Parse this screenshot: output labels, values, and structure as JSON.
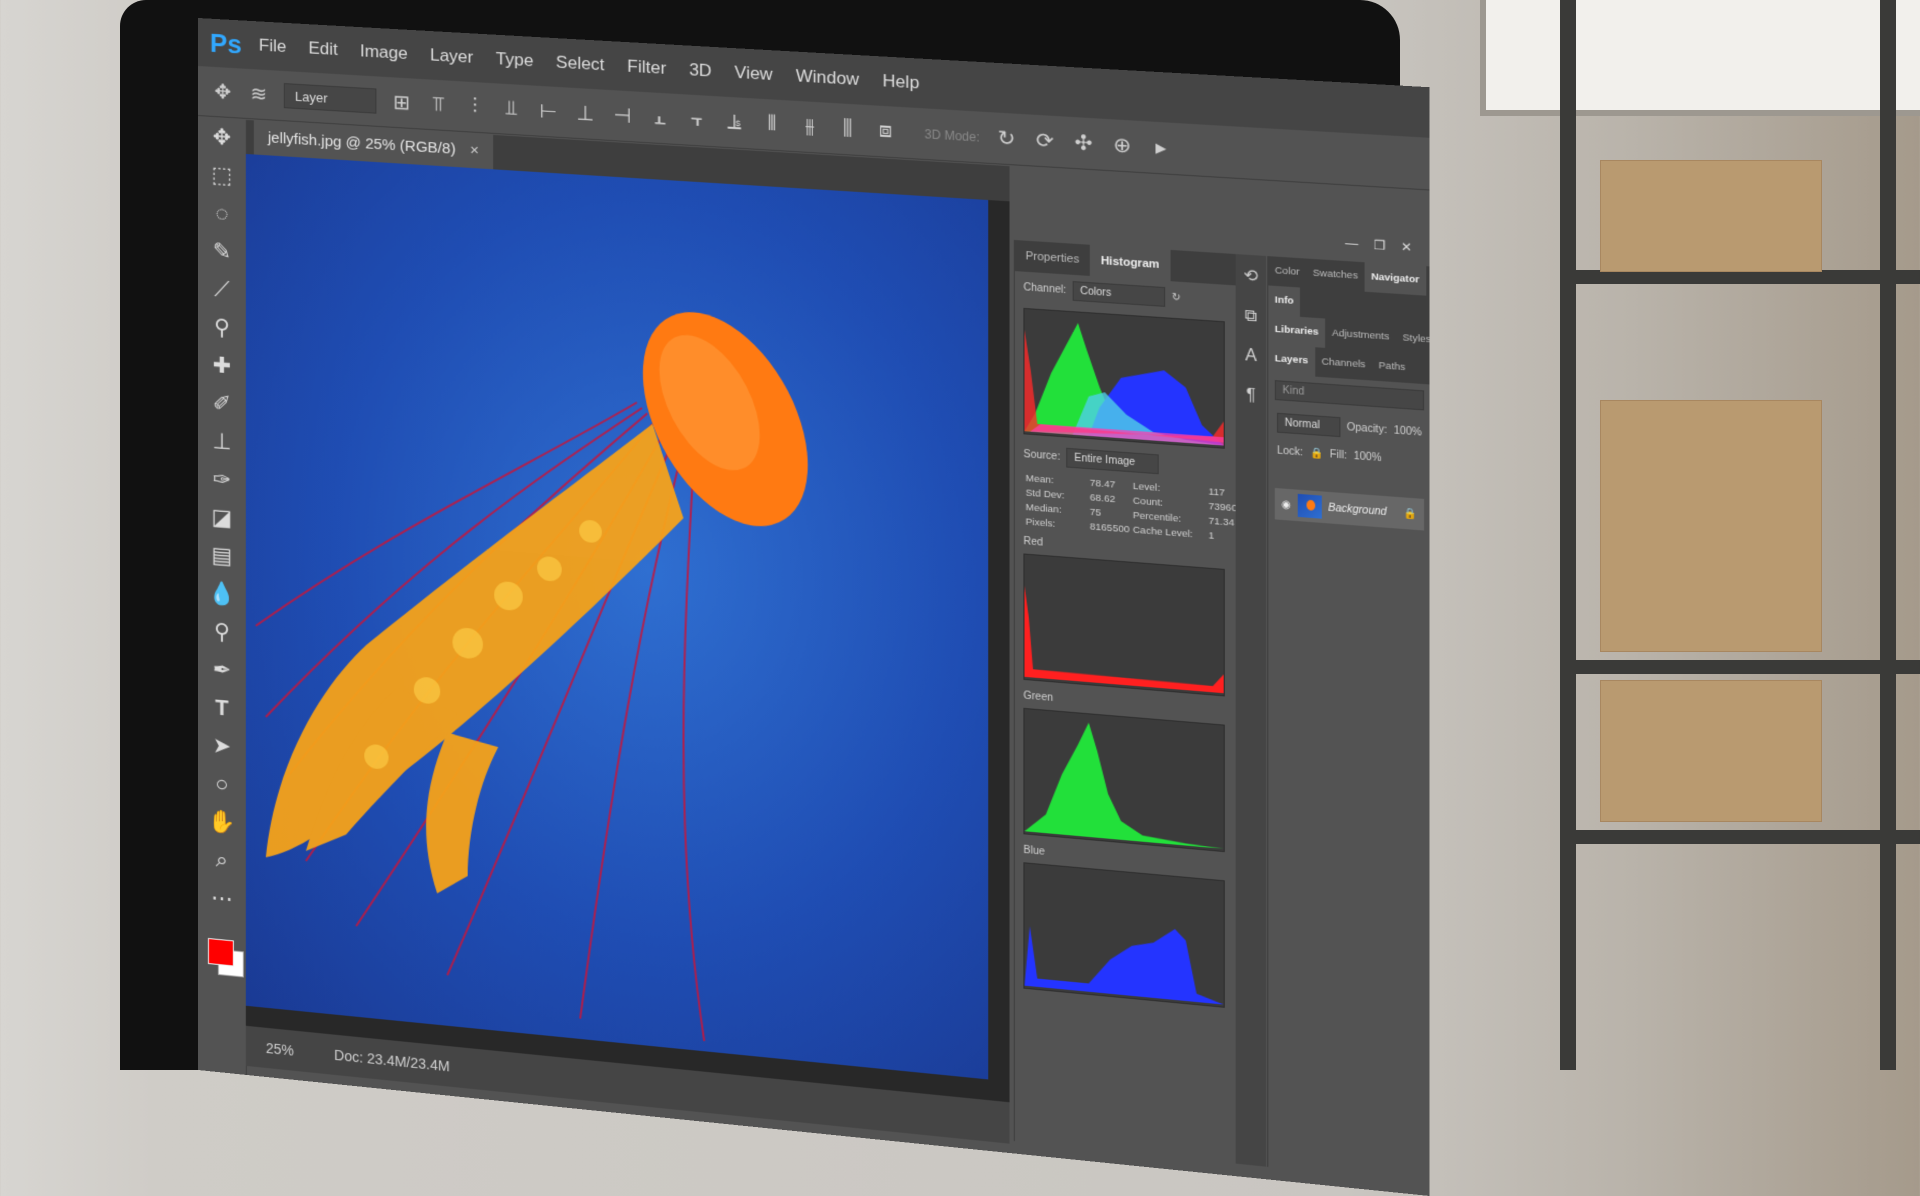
{
  "app": {
    "logo": "Ps",
    "menu": [
      "File",
      "Edit",
      "Image",
      "Layer",
      "Type",
      "Select",
      "Filter",
      "3D",
      "View",
      "Window",
      "Help"
    ]
  },
  "options_bar": {
    "auto_select": "Layer",
    "mode_3d": "3D Mode:"
  },
  "document": {
    "tab_title": "jellyfish.jpg @ 25% (RGB/8)",
    "close_glyph": "×",
    "zoom": "25%",
    "doc_info": "Doc: 23.4M/23.4M"
  },
  "histogram_panel": {
    "tabs": [
      "Properties",
      "Histogram"
    ],
    "active_tab": "Histogram",
    "channel_label": "Channel:",
    "channel_value": "Colors",
    "source_label": "Source:",
    "source_value": "Entire Image",
    "stats": {
      "mean_label": "Mean:",
      "mean": "78.47",
      "std_dev_label": "Std Dev:",
      "std_dev": "68.62",
      "median_label": "Median:",
      "median": "75",
      "pixels_label": "Pixels:",
      "pixels": "8165500",
      "level_label": "Level:",
      "level": "117",
      "count_label": "Count:",
      "count": "73960",
      "percentile_label": "Percentile:",
      "percentile": "71.34",
      "cache_label": "Cache Level:",
      "cache": "1"
    },
    "channels": [
      "Red",
      "Green",
      "Blue"
    ]
  },
  "right_panel": {
    "tabs_top": [
      "Color",
      "Swatches",
      "Navigator"
    ],
    "info_tab": "Info",
    "tabs_mid": [
      "Libraries",
      "Adjustments",
      "Styles"
    ],
    "tabs_layers": [
      "Layers",
      "Channels",
      "Paths"
    ],
    "search_placeholder": "Kind",
    "blend_mode": "Normal",
    "opacity_label": "Opacity:",
    "opacity_value": "100%",
    "lock_label": "Lock:",
    "fill_label": "Fill:",
    "fill_value": "100%",
    "layer_name": "Background"
  },
  "colors": {
    "foreground": "#ff0000",
    "background": "#ffffff",
    "accent": "#31a8ff",
    "jellyfish": "#ff7a12"
  }
}
